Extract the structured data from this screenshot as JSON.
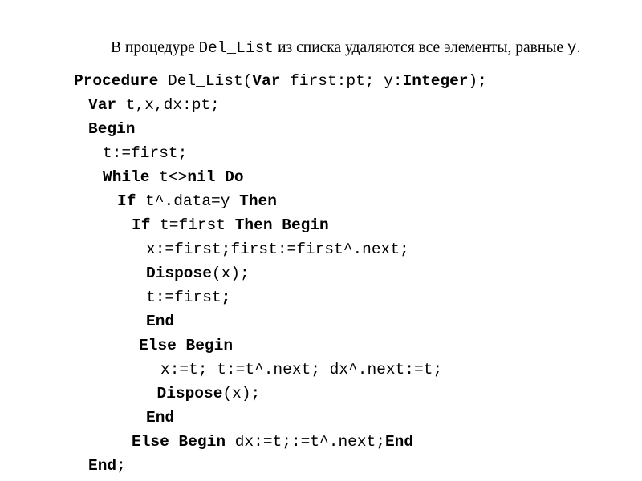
{
  "document": {
    "background_color": "#ffffff",
    "text_color": "#000000"
  },
  "intro": {
    "part1": "В процедуре ",
    "code_name": "Del_List",
    "part2": " из списка удаляются все элементы, равные ",
    "variable": "y",
    "part3": "."
  },
  "code": {
    "language": "Pascal",
    "lines": [
      {
        "indent": 0,
        "segments": [
          {
            "text": "Procedure",
            "bold": true
          },
          {
            "text": " Del_List(",
            "bold": false
          },
          {
            "text": "Var",
            "bold": true
          },
          {
            "text": " first:pt; y:",
            "bold": false
          },
          {
            "text": "Integer",
            "bold": true
          },
          {
            "text": ");",
            "bold": false
          }
        ]
      },
      {
        "indent": 1,
        "segments": [
          {
            "text": "Var",
            "bold": true
          },
          {
            "text": " t,x,dx:pt;",
            "bold": false
          }
        ]
      },
      {
        "indent": 1,
        "segments": [
          {
            "text": "Begin",
            "bold": true
          }
        ]
      },
      {
        "indent": 2,
        "segments": [
          {
            "text": "t:=first;",
            "bold": false
          }
        ]
      },
      {
        "indent": 2,
        "segments": [
          {
            "text": "While",
            "bold": true
          },
          {
            "text": " t<>",
            "bold": false
          },
          {
            "text": "nil Do",
            "bold": true
          }
        ]
      },
      {
        "indent": 3,
        "segments": [
          {
            "text": "If",
            "bold": true
          },
          {
            "text": " t^.data=y ",
            "bold": false
          },
          {
            "text": "Then",
            "bold": true
          }
        ]
      },
      {
        "indent": 4,
        "segments": [
          {
            "text": "If",
            "bold": true
          },
          {
            "text": " t=first ",
            "bold": false
          },
          {
            "text": "Then Begin",
            "bold": true
          }
        ]
      },
      {
        "indent": 5,
        "segments": [
          {
            "text": "x:=first;first:=first^.next;",
            "bold": false
          }
        ]
      },
      {
        "indent": 5,
        "segments": [
          {
            "text": "Dispose",
            "bold": true
          },
          {
            "text": "(x);",
            "bold": false
          }
        ]
      },
      {
        "indent": 5,
        "segments": [
          {
            "text": "t:=first",
            "bold": false
          },
          {
            "text": ";",
            "bold": true
          }
        ]
      },
      {
        "indent": 5,
        "segments": [
          {
            "text": "End",
            "bold": true
          }
        ]
      },
      {
        "indent": 5,
        "segments": [
          {
            "text": "Else Begin",
            "bold": true
          }
        ],
        "offset": -0.5
      },
      {
        "indent": 6,
        "segments": [
          {
            "text": "x:=t; t:=t^.next; dx^.next:=t;",
            "bold": false
          }
        ]
      },
      {
        "indent": 6,
        "segments": [
          {
            "text": "Dispose",
            "bold": true
          },
          {
            "text": "(x);",
            "bold": false
          }
        ],
        "offset": -0.25
      },
      {
        "indent": 5,
        "segments": [
          {
            "text": "End",
            "bold": true
          }
        ]
      },
      {
        "indent": 4,
        "segments": [
          {
            "text": "Else Begin",
            "bold": true
          },
          {
            "text": " dx:=t;:=t^.next;",
            "bold": false
          },
          {
            "text": "End",
            "bold": true
          }
        ]
      },
      {
        "indent": 1,
        "segments": [
          {
            "text": "End",
            "bold": true
          },
          {
            "text": ";",
            "bold": false
          }
        ]
      }
    ]
  }
}
